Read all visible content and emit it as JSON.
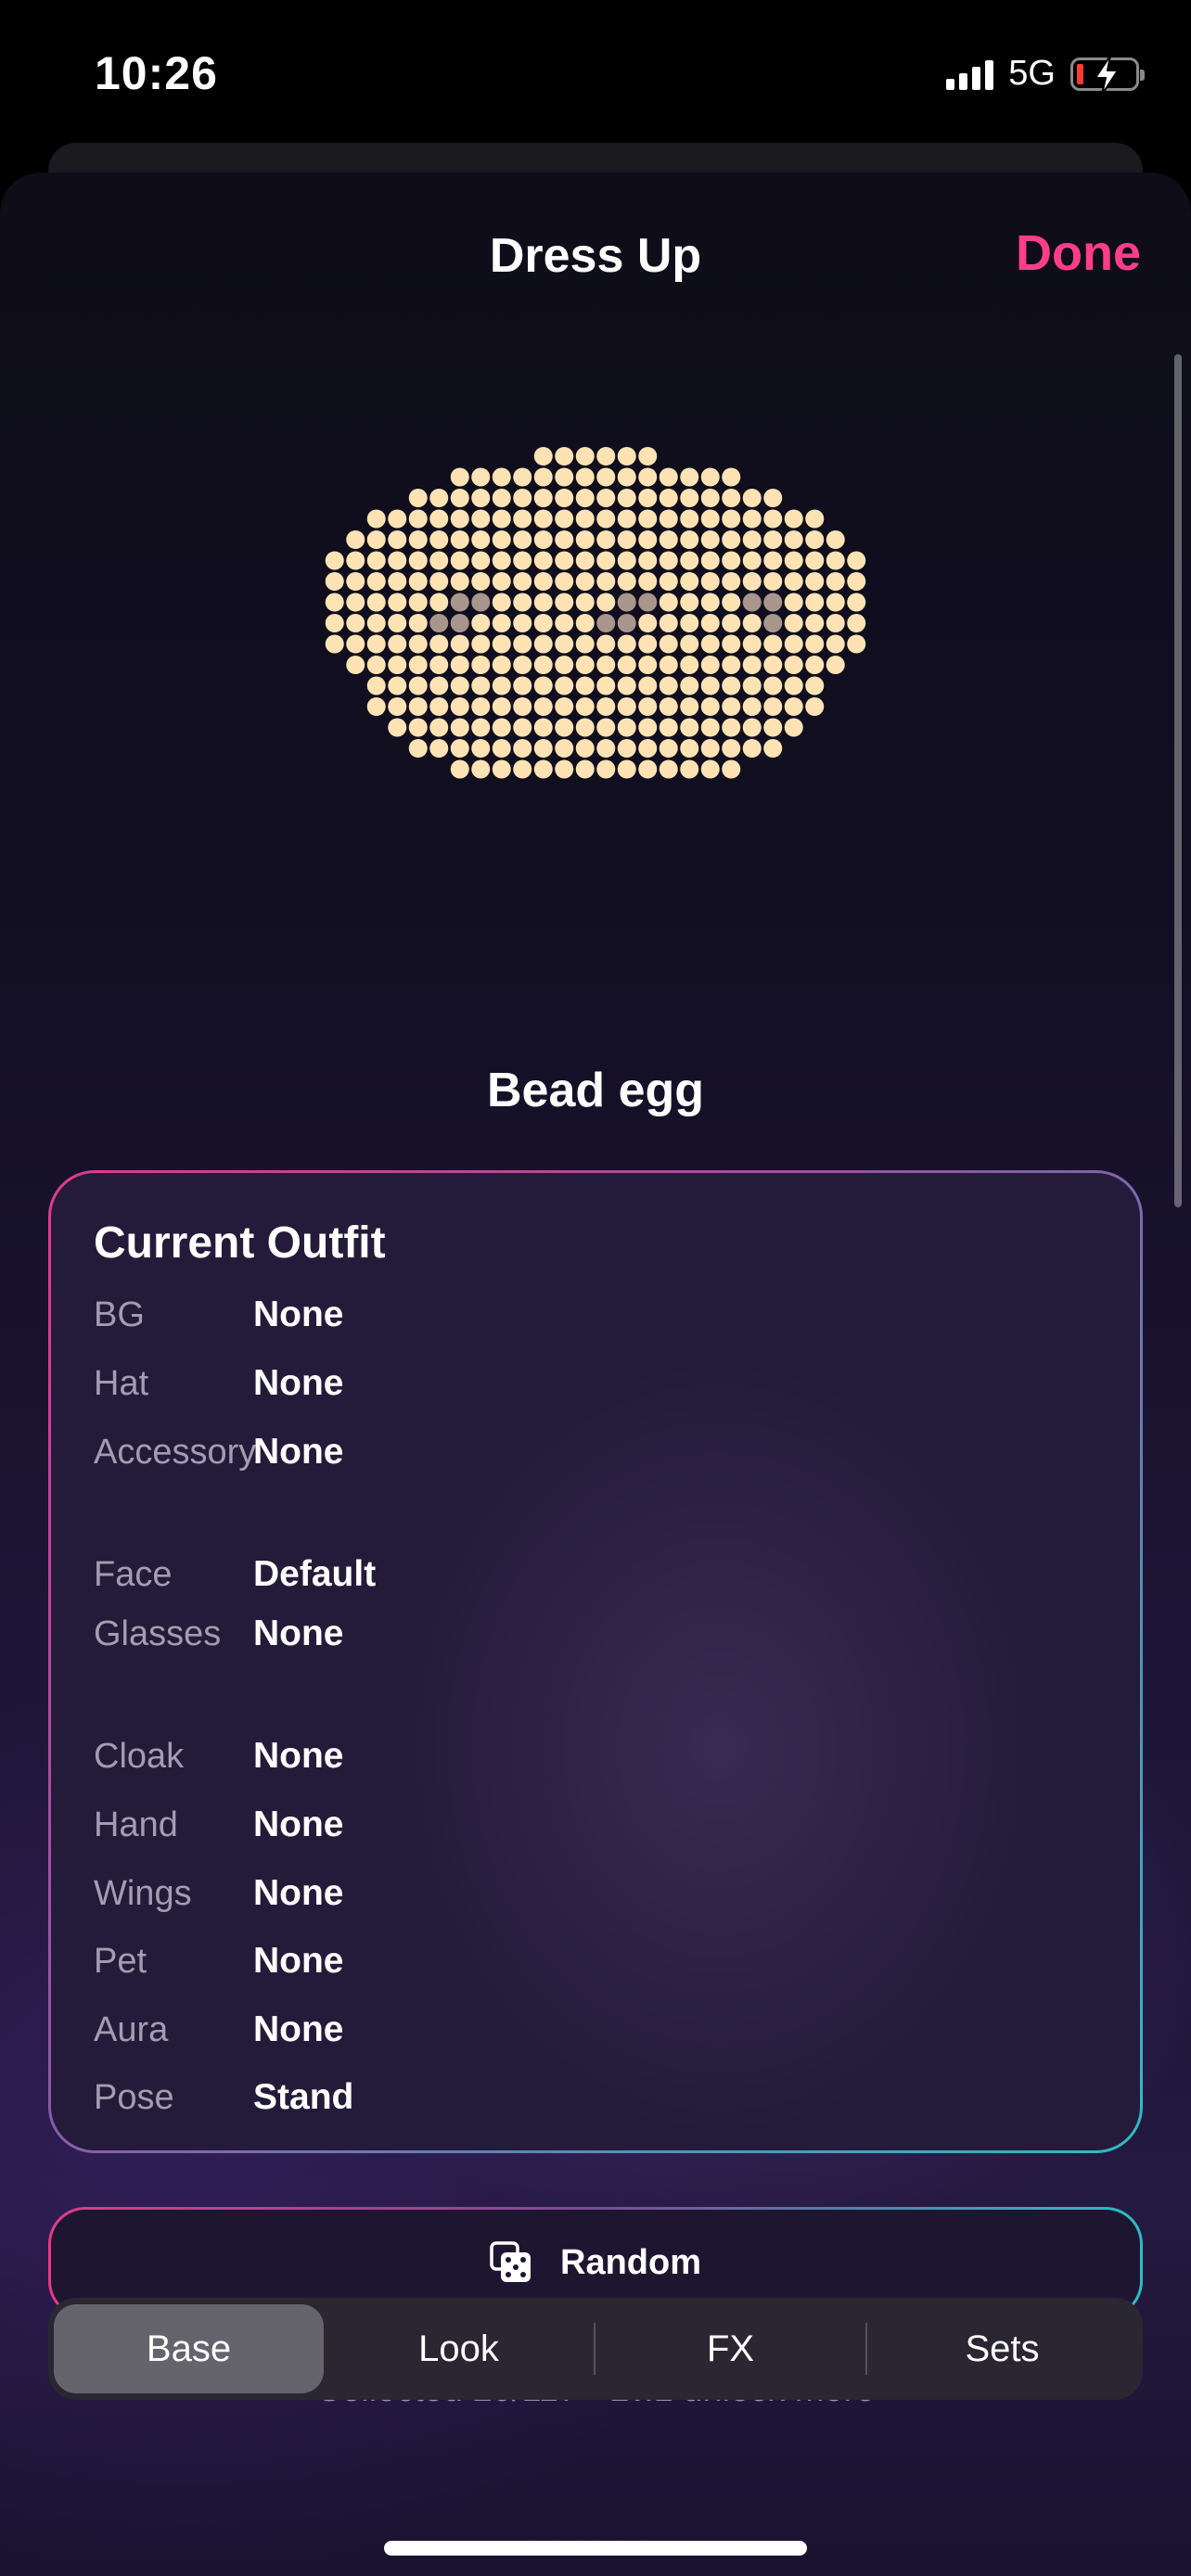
{
  "status": {
    "time": "10:26",
    "network": "5G"
  },
  "header": {
    "title": "Dress Up",
    "done_label": "Done"
  },
  "avatar": {
    "name": "Bead egg"
  },
  "outfit": {
    "title": "Current Outfit",
    "rows": [
      {
        "key": "BG",
        "value": "None"
      },
      {
        "key": "Hat",
        "value": "None"
      },
      {
        "key": "Accessory",
        "value": "None"
      },
      {
        "key": "Face",
        "value": "Default"
      },
      {
        "key": "Glasses",
        "value": "None"
      },
      {
        "key": "Cloak",
        "value": "None"
      },
      {
        "key": "Hand",
        "value": "None"
      },
      {
        "key": "Wings",
        "value": "None"
      },
      {
        "key": "Pet",
        "value": "None"
      },
      {
        "key": "Aura",
        "value": "None"
      },
      {
        "key": "Pose",
        "value": "Stand"
      }
    ]
  },
  "random": {
    "label": "Random"
  },
  "collected_text": "Collected 20/117 · Lv.1 unlock more",
  "tabs": [
    {
      "label": "Base",
      "active": true
    },
    {
      "label": "Look",
      "active": false
    },
    {
      "label": "FX",
      "active": false
    },
    {
      "label": "Sets",
      "active": false
    }
  ],
  "colors": {
    "accent": "#ff3d8a",
    "bead": "#fde3b4",
    "bead_eye": "#a8958c"
  }
}
